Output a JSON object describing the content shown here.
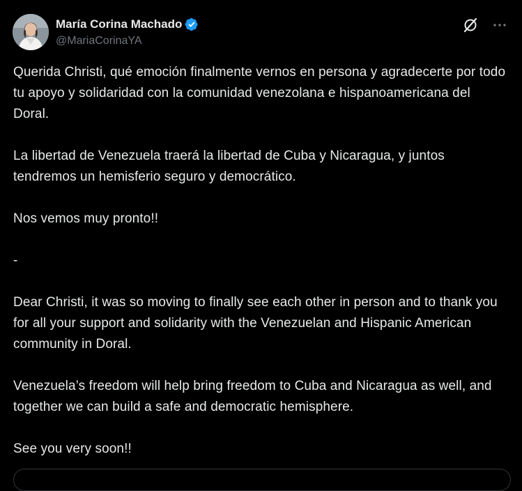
{
  "author": {
    "display_name": "María Corina Machado",
    "handle": "@MariaCorinaYA",
    "verified": true,
    "verified_color": "#1d9bf0"
  },
  "header_icons": {
    "grok": "grok-icon",
    "more": "more-icon"
  },
  "post": {
    "paragraphs": [
      "Querida Christi, qué emoción finalmente vernos en persona y agradecerte por todo tu apoyo y solidaridad con la comunidad venezolana e hispanoamericana del Doral.",
      "La libertad de Venezuela traerá la libertad de Cuba y Nicaragua, y juntos tendremos un hemisferio seguro y democrático.",
      "Nos vemos muy pronto!!",
      "-",
      "Dear Christi, it was so moving to finally see each other in person and to thank you for all your support and solidarity with the Venezuelan and Hispanic American community in Doral.",
      "Venezuela’s freedom will help bring freedom to Cuba and Nicaragua as well, and together we can build a safe and democratic hemisphere.",
      "See you very soon!!"
    ]
  },
  "colors": {
    "background": "#000000",
    "text": "#e7e9ea",
    "secondary_text": "#71767b",
    "border": "#2f3336"
  }
}
